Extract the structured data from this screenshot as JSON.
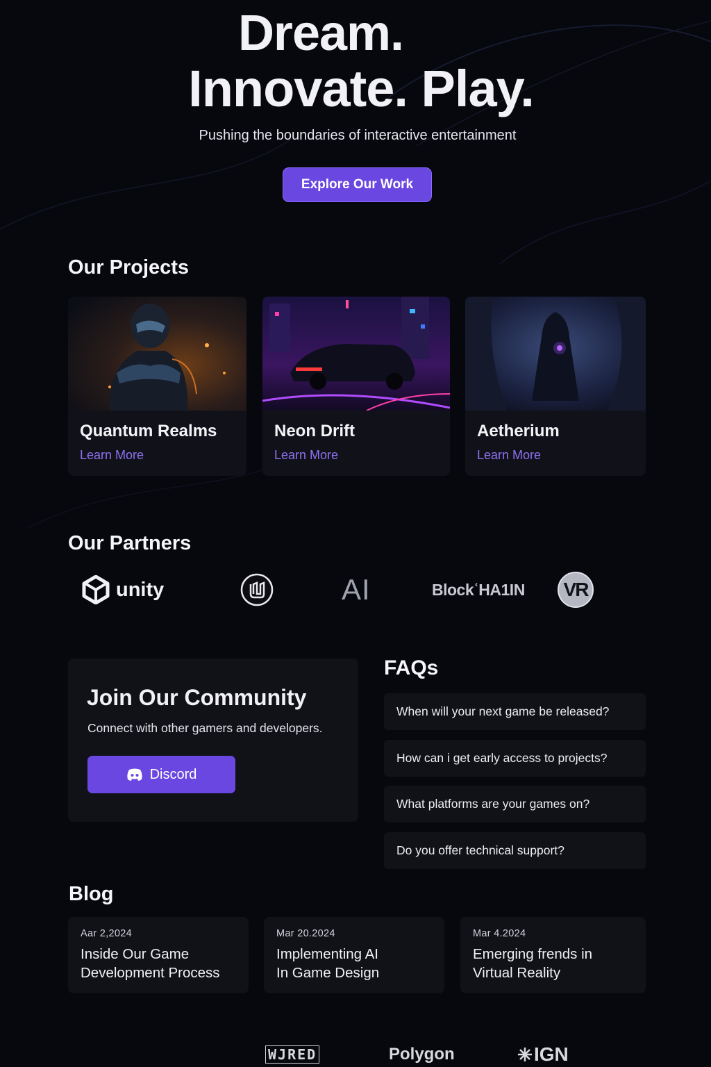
{
  "hero": {
    "title_line1": "Dream.",
    "title_line2": "Innovate. Play.",
    "subtitle": "Pushing the boundaries of interactive entertainment",
    "cta_label": "Explore Our Work"
  },
  "projects": {
    "heading": "Our Projects",
    "items": [
      {
        "name": "Quantum Realms",
        "link_label": "Learn More"
      },
      {
        "name": "Neon Drift",
        "link_label": "Learn More"
      },
      {
        "name": "Aetherium",
        "link_label": "Learn More"
      }
    ]
  },
  "partners": {
    "heading": "Our Partners",
    "items": [
      {
        "label": "unity",
        "icon": "unity-logo-icon"
      },
      {
        "label": "",
        "icon": "unreal-engine-logo-icon"
      },
      {
        "label": "AI",
        "icon": "ai-logo"
      },
      {
        "label": "BlockʿHA1IN",
        "icon": "blockchain-logo"
      },
      {
        "label": "VR",
        "icon": "vr-logo-icon"
      }
    ]
  },
  "community": {
    "title": "Join Our Community",
    "subtitle": "Connect with other gamers and developers.",
    "button_label": "Discord"
  },
  "faqs": {
    "heading": "FAQs",
    "items": [
      "When will your next game be released?",
      "How can i get early access to projects?",
      "What platforms are your games on?",
      "Do you offer technical support?"
    ]
  },
  "blog": {
    "heading": "Blog",
    "posts": [
      {
        "date": "Aar 2,2024",
        "title": "Inside Our Game\nDevelopment Process"
      },
      {
        "date": "Mar 20.2024",
        "title": "Implementing  AI\nIn Game Design"
      },
      {
        "date": "Mar 4.2024",
        "title": "Emerging frends in\nVirtual Reality"
      }
    ]
  },
  "press": {
    "items": [
      {
        "label": "WJRED",
        "icon": "wired-logo"
      },
      {
        "label": "Polygon",
        "icon": "polygon-logo"
      },
      {
        "label": "IGN",
        "icon": "ign-logo"
      }
    ]
  },
  "colors": {
    "background": "#07080d",
    "accent": "#6a47e0",
    "link": "#8f72f2",
    "card": "#111217"
  }
}
